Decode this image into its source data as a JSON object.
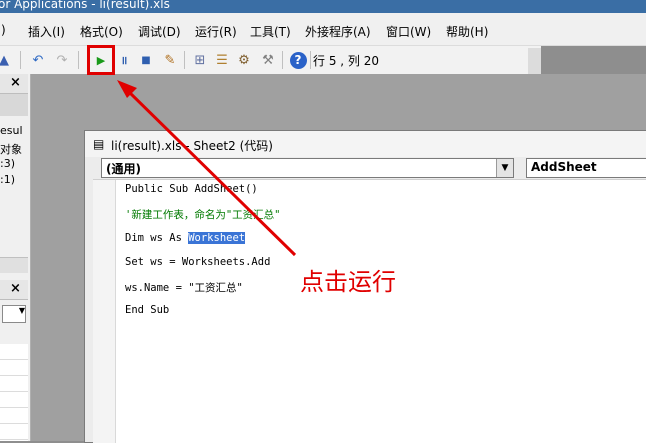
{
  "window": {
    "title": "or Applications - li(result).xls"
  },
  "menu": {
    "items": [
      "插入(I)",
      "格式(O)",
      "调试(D)",
      "运行(R)",
      "工具(T)",
      "外接程序(A)",
      "窗口(W)",
      "帮助(H)"
    ]
  },
  "toolbar": {
    "status": "行 5 , 列 20"
  },
  "left_panel": {
    "lines": [
      "esul",
      "对象",
      ":3)",
      ":1)"
    ]
  },
  "code_window": {
    "title": "li(result).xls - Sheet2 (代码)",
    "object_combo": "(通用)",
    "proc_combo": "AddSheet",
    "lines": {
      "l1": "Public Sub AddSheet()",
      "l2": "'新建工作表，命名为\"工资汇总\"",
      "l3a": "Dim ws As ",
      "l3b": "Worksheet",
      "l4": "Set ws = Worksheets.Add",
      "l5": "ws.Name = \"工资汇总\"",
      "l6": "End Sub"
    }
  },
  "annotation": {
    "text": "点击运行",
    "color": "#e00000"
  }
}
